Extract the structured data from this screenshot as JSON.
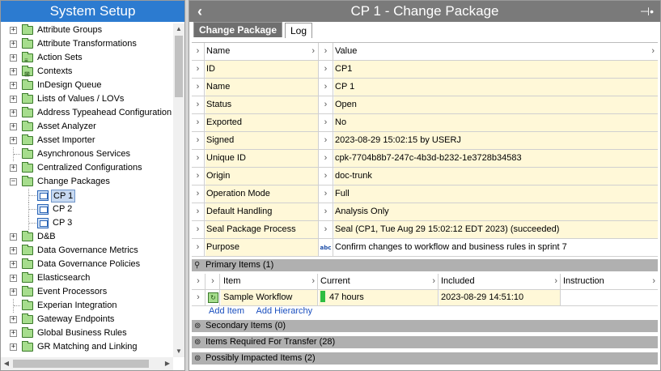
{
  "left_panel": {
    "title": "System Setup",
    "tree_items": [
      {
        "label": "Attribute Groups",
        "glyph": "",
        "expandable": true
      },
      {
        "label": "Attribute Transformations",
        "glyph": "",
        "expandable": true
      },
      {
        "label": "Action Sets",
        "glyph": "≡",
        "expandable": true
      },
      {
        "label": "Contexts",
        "glyph": "⊞",
        "expandable": true
      },
      {
        "label": "InDesign Queue",
        "glyph": "",
        "expandable": true
      },
      {
        "label": "Lists of Values / LOVs",
        "glyph": "",
        "expandable": true
      },
      {
        "label": "Address Typeahead Configuration",
        "glyph": "",
        "expandable": true
      },
      {
        "label": "Asset Analyzer",
        "glyph": "",
        "expandable": true
      },
      {
        "label": "Asset Importer",
        "glyph": "",
        "expandable": true
      },
      {
        "label": "Asynchronous Services",
        "glyph": "",
        "expandable": false
      },
      {
        "label": "Centralized Configurations",
        "glyph": "",
        "expandable": true
      },
      {
        "label": "Change Packages",
        "glyph": "",
        "expandable": true,
        "expanded": true
      }
    ],
    "change_package_children": [
      {
        "label": "CP 1",
        "selected": true
      },
      {
        "label": "CP 2",
        "selected": false
      },
      {
        "label": "CP 3",
        "selected": false
      }
    ],
    "tree_items_after": [
      {
        "label": "D&B",
        "glyph": "",
        "expandable": true
      },
      {
        "label": "Data Governance Metrics",
        "glyph": "",
        "expandable": true
      },
      {
        "label": "Data Governance Policies",
        "glyph": "",
        "expandable": true
      },
      {
        "label": "Elasticsearch",
        "glyph": "",
        "expandable": true
      },
      {
        "label": "Event Processors",
        "glyph": "",
        "expandable": true
      },
      {
        "label": "Experian Integration",
        "glyph": "",
        "expandable": false
      },
      {
        "label": "Gateway Endpoints",
        "glyph": "",
        "expandable": true
      },
      {
        "label": "Global Business Rules",
        "glyph": "",
        "expandable": true
      },
      {
        "label": "GR Matching and Linking",
        "glyph": "",
        "expandable": true
      }
    ]
  },
  "right_panel": {
    "title": "CP 1 - Change Package",
    "tabs": {
      "active": "Change Package",
      "inactive": "Log"
    },
    "properties_header": {
      "name": "Name",
      "value": "Value"
    },
    "properties": [
      {
        "name": "ID",
        "value": "CP1"
      },
      {
        "name": "Name",
        "value": "CP 1"
      },
      {
        "name": "Status",
        "value": "Open"
      },
      {
        "name": "Exported",
        "value": "No"
      },
      {
        "name": "Signed",
        "value": "2023-08-29 15:02:15 by USERJ"
      },
      {
        "name": "Unique ID",
        "value": "cpk-7704b8b7-247c-4b3d-b232-1e3728b34583"
      },
      {
        "name": "Origin",
        "value": "doc-trunk"
      },
      {
        "name": "Operation Mode",
        "value": "Full"
      },
      {
        "name": "Default Handling",
        "value": "Analysis Only"
      },
      {
        "name": "Seal Package Process",
        "value": "Seal (CP1, Tue Aug 29 15:02:12 EDT 2023) (succeeded)"
      },
      {
        "name": "Purpose",
        "value": "Confirm changes to workflow and business rules in sprint 7",
        "abc": "abc"
      }
    ],
    "primary_items": {
      "title": "Primary Items (1)",
      "headers": {
        "item": "Item",
        "current": "Current",
        "included": "Included",
        "instruction": "Instruction"
      },
      "rows": [
        {
          "item": "Sample Workflow",
          "current": "47 hours",
          "included": "2023-08-29 14:51:10",
          "instruction": ""
        }
      ],
      "add_item": "Add Item",
      "add_hierarchy": "Add Hierarchy"
    },
    "sections": [
      {
        "title": "Secondary Items (0)"
      },
      {
        "title": "Items Required For Transfer (28)"
      },
      {
        "title": "Possibly Impacted Items (2)"
      }
    ]
  }
}
